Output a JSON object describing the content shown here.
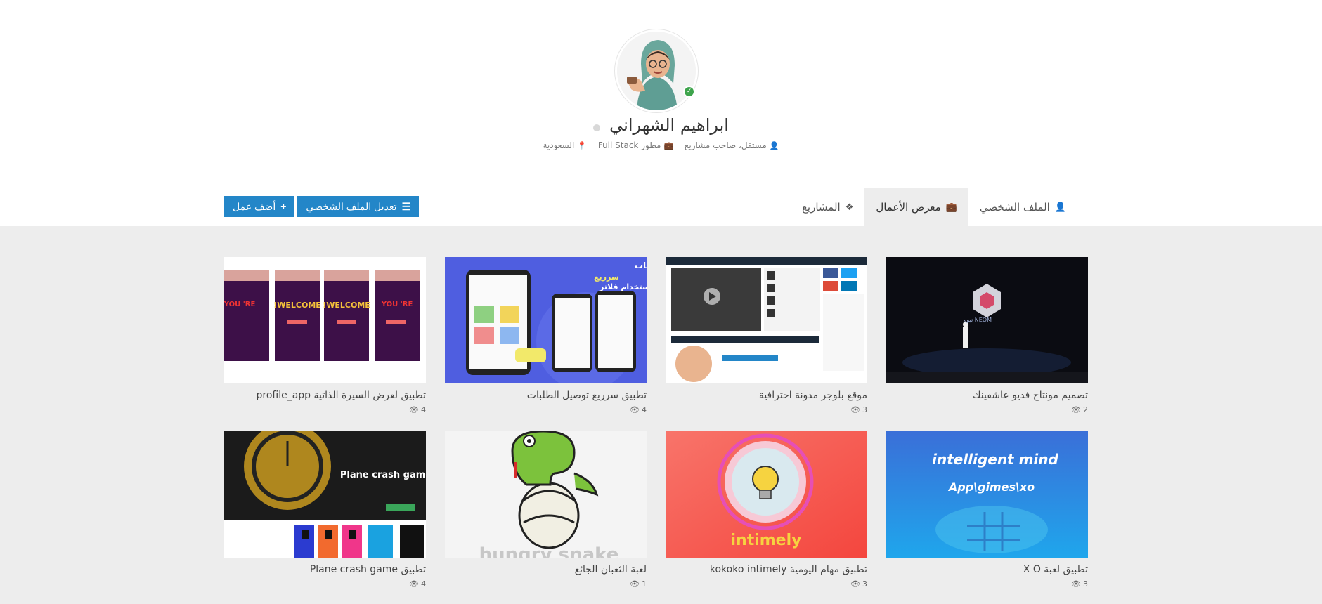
{
  "profile": {
    "name": "ابراهيم الشهراني",
    "role": "مستقل، صاحب مشاريع",
    "job": "مطور Full Stack",
    "location": "السعودية"
  },
  "tabs": [
    {
      "label": "الملف الشخصي",
      "icon": "user-icon",
      "active": false
    },
    {
      "label": "معرض الأعمال",
      "icon": "briefcase-icon",
      "active": true
    },
    {
      "label": "المشاريع",
      "icon": "cubes-icon",
      "active": false
    }
  ],
  "actions": {
    "add_work": "أضف عمل",
    "edit_profile": "تعديل الملف الشخصي"
  },
  "works": [
    {
      "title": "تصميم مونتاج فديو عاشقينك",
      "views": "2",
      "thumb_text": "NEOM نيوم"
    },
    {
      "title": "موقع بلوجر مدونة احترافية",
      "views": "3",
      "thumb_text": ""
    },
    {
      "title": "تطبيق سرريع توصيل الطلبات",
      "views": "4",
      "thumb_text": "تطبيق توصيل الطلبات",
      "thumb_text2": "سرريع",
      "thumb_text3": "باستخدام فلاتر"
    },
    {
      "title": "تطبيق لعرض السيرة الذاتية profile_app",
      "views": "4",
      "thumb_text": "YOU 'RE",
      "thumb_text2": "WELCOME!"
    },
    {
      "title": "تطبيق لعبة X O",
      "views": "3",
      "thumb_text": "intelligent mind",
      "thumb_text2": "App\\gimes\\xo"
    },
    {
      "title": "تطبيق مهام اليومية kokoko intimely",
      "views": "3",
      "thumb_text": "intimely"
    },
    {
      "title": "لعبة الثعبان الجائع",
      "views": "1",
      "thumb_text": "hungry snake"
    },
    {
      "title": "تطبيق Plane crash game",
      "views": "4",
      "thumb_text": "Plane crash game"
    }
  ],
  "colors": {
    "primary_button": "#2386c8",
    "online": "#3ea44c",
    "gallery_bg": "#ededed"
  }
}
